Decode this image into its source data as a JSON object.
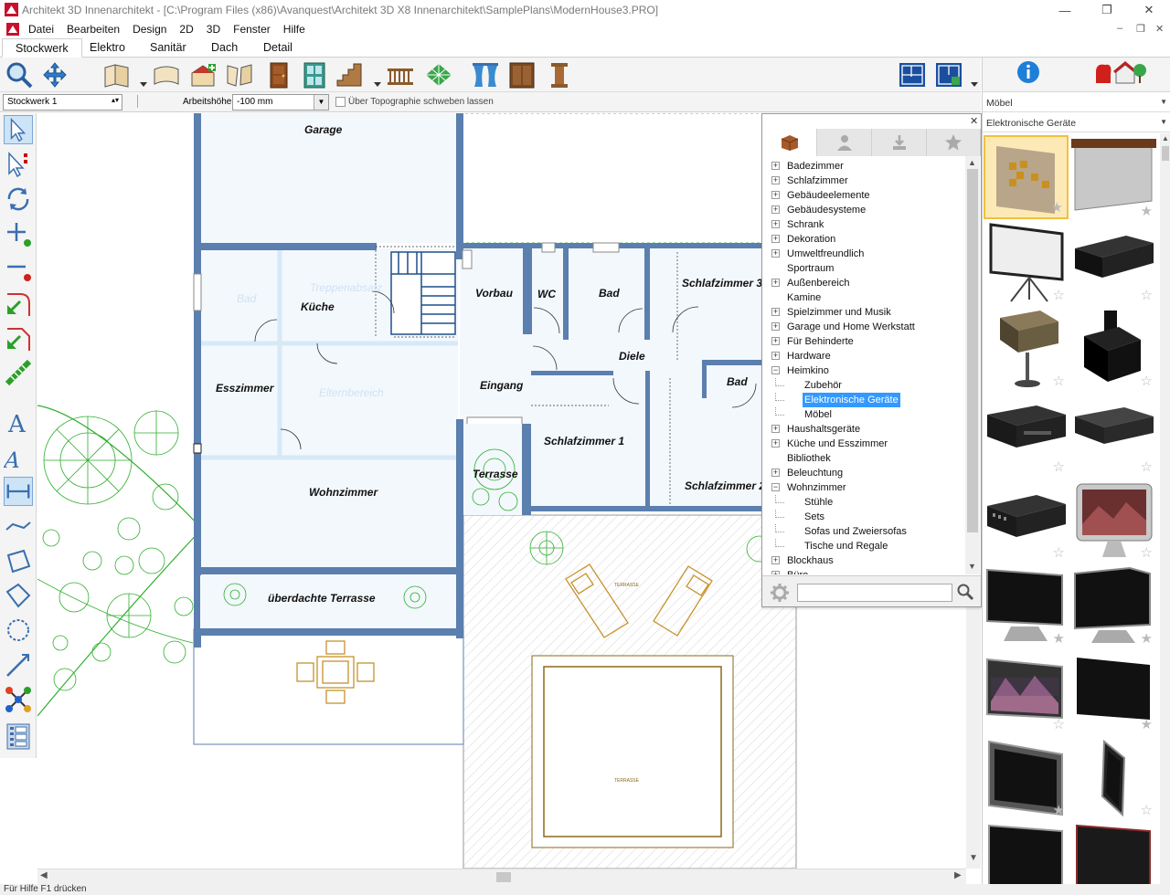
{
  "window": {
    "title": "Architekt 3D Innenarchitekt - [C:\\Program Files (x86)\\Avanquest\\Architekt 3D X8 Innenarchitekt\\SamplePlans\\ModernHouse3.PRO]",
    "minimize": "—",
    "restore": "❐",
    "close": "✕",
    "mdi_minimize": "–",
    "mdi_restore": "❐",
    "mdi_close": "✕"
  },
  "menu": [
    "Datei",
    "Bearbeiten",
    "Design",
    "2D",
    "3D",
    "Fenster",
    "Hilfe"
  ],
  "tabs": [
    {
      "label": "Stockwerk",
      "active": true
    },
    {
      "label": "Elektro"
    },
    {
      "label": "Sanitär"
    },
    {
      "label": "Dach"
    },
    {
      "label": "Detail"
    }
  ],
  "options": {
    "floor_select": "Stockwerk 1",
    "work_height_label": "Arbeitshöhe:",
    "work_height_value": "-100 mm",
    "topography_checkbox": "Über Topographie schweben lassen"
  },
  "rooms": {
    "garage": "Garage",
    "kueche": "Küche",
    "vorbau": "Vorbau",
    "wc": "WC",
    "bad1": "Bad",
    "schlafzimmer3": "Schlafzimmer 3",
    "diele": "Diele",
    "bad2": "Bad",
    "esszimmer": "Esszimmer",
    "eingang": "Eingang",
    "schlafzimmer1": "Schlafzimmer 1",
    "schlafzimmer2": "Schlafzimmer 2",
    "wohnzimmer": "Wohnzimmer",
    "terrasse": "Terrasse",
    "ueberdachte_terrasse": "überdachte Terrasse",
    "faint_bad": "Bad",
    "faint_treppe": "Treppenabsatz",
    "faint_eltern": "Elternbereich",
    "terrasse_small_1": "TERRASSE",
    "terrasse_small_2": "TERRASSE"
  },
  "right_panel": {
    "category_1": "Möbel",
    "category_2": "Elektronische Geräte"
  },
  "catalog_tree": [
    {
      "label": "Badezimmer",
      "level": 0,
      "expander": "+"
    },
    {
      "label": "Schlafzimmer",
      "level": 0,
      "expander": "+"
    },
    {
      "label": "Gebäudeelemente",
      "level": 0,
      "expander": "+"
    },
    {
      "label": "Gebäudesysteme",
      "level": 0,
      "expander": "+"
    },
    {
      "label": "Schrank",
      "level": 0,
      "expander": "+"
    },
    {
      "label": "Dekoration",
      "level": 0,
      "expander": "+"
    },
    {
      "label": "Umweltfreundlich",
      "level": 0,
      "expander": "+"
    },
    {
      "label": "Sportraum",
      "level": 0,
      "expander": ""
    },
    {
      "label": "Außenbereich",
      "level": 0,
      "expander": "+"
    },
    {
      "label": "Kamine",
      "level": 0,
      "expander": ""
    },
    {
      "label": "Spielzimmer und Musik",
      "level": 0,
      "expander": "+"
    },
    {
      "label": "Garage und Home Werkstatt",
      "level": 0,
      "expander": "+"
    },
    {
      "label": "Für Behinderte",
      "level": 0,
      "expander": "+"
    },
    {
      "label": "Hardware",
      "level": 0,
      "expander": "+"
    },
    {
      "label": "Heimkino",
      "level": 0,
      "expander": "−"
    },
    {
      "label": "Zubehör",
      "level": 1,
      "expander": ""
    },
    {
      "label": "Elektronische Geräte",
      "level": 1,
      "expander": "",
      "selected": true
    },
    {
      "label": "Möbel",
      "level": 1,
      "expander": ""
    },
    {
      "label": "Haushaltsgeräte",
      "level": 0,
      "expander": "+"
    },
    {
      "label": "Küche und Esszimmer",
      "level": 0,
      "expander": "+"
    },
    {
      "label": "Bibliothek",
      "level": 0,
      "expander": ""
    },
    {
      "label": "Beleuchtung",
      "level": 0,
      "expander": "+"
    },
    {
      "label": "Wohnzimmer",
      "level": 0,
      "expander": "−"
    },
    {
      "label": "Stühle",
      "level": 1,
      "expander": ""
    },
    {
      "label": "Sets",
      "level": 1,
      "expander": ""
    },
    {
      "label": "Sofas und Zweiersofas",
      "level": 1,
      "expander": ""
    },
    {
      "label": "Tische und Regale",
      "level": 1,
      "expander": ""
    },
    {
      "label": "Blockhaus",
      "level": 0,
      "expander": "+"
    },
    {
      "label": "Büro",
      "level": 0,
      "expander": "+"
    }
  ],
  "search": {
    "value": ""
  },
  "status": "Für Hilfe F1 drücken",
  "colors": {
    "wall": "#5b7fae",
    "selection": "#3399ff",
    "plants": "#2eae2e",
    "furniture": "#c7922c"
  }
}
